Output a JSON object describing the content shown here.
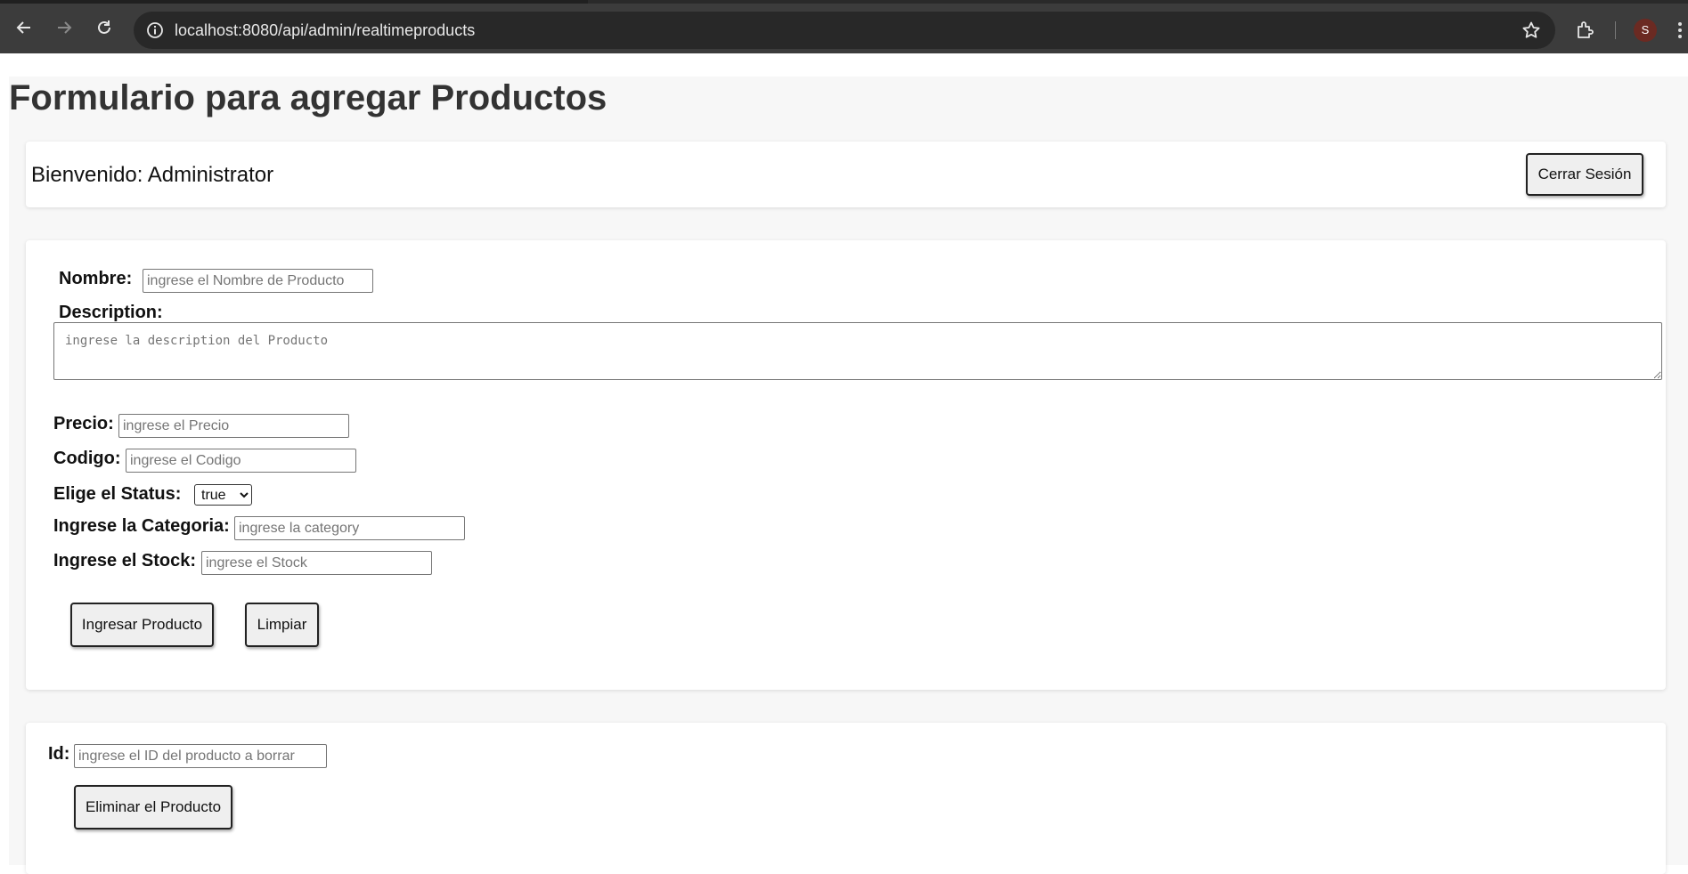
{
  "browser": {
    "url": "localhost:8080/api/admin/realtimeproducts",
    "avatar_letter": "S"
  },
  "page": {
    "title": "Formulario para agregar Productos"
  },
  "header": {
    "welcome": "Bienvenido: Administrator",
    "logout_label": "Cerrar Sesión"
  },
  "form": {
    "name_label": "Nombre:",
    "name_placeholder": "ingrese el Nombre de Producto",
    "description_label": "Description:",
    "description_placeholder": "ingrese la description del Producto",
    "price_label": "Precio:",
    "price_placeholder": "ingrese el Precio",
    "code_label": "Codigo:",
    "code_placeholder": "ingrese el Codigo",
    "status_label": "Elige el Status:",
    "status_value": "true",
    "category_label": "Ingrese la Categoria:",
    "category_placeholder": "ingrese la category",
    "stock_label": "Ingrese el Stock:",
    "stock_placeholder": "ingrese el Stock",
    "submit_label": "Ingresar Producto",
    "clear_label": "Limpiar"
  },
  "delete": {
    "id_label": "Id:",
    "id_placeholder": "ingrese el ID del producto a borrar",
    "delete_label": "Eliminar el Producto"
  }
}
